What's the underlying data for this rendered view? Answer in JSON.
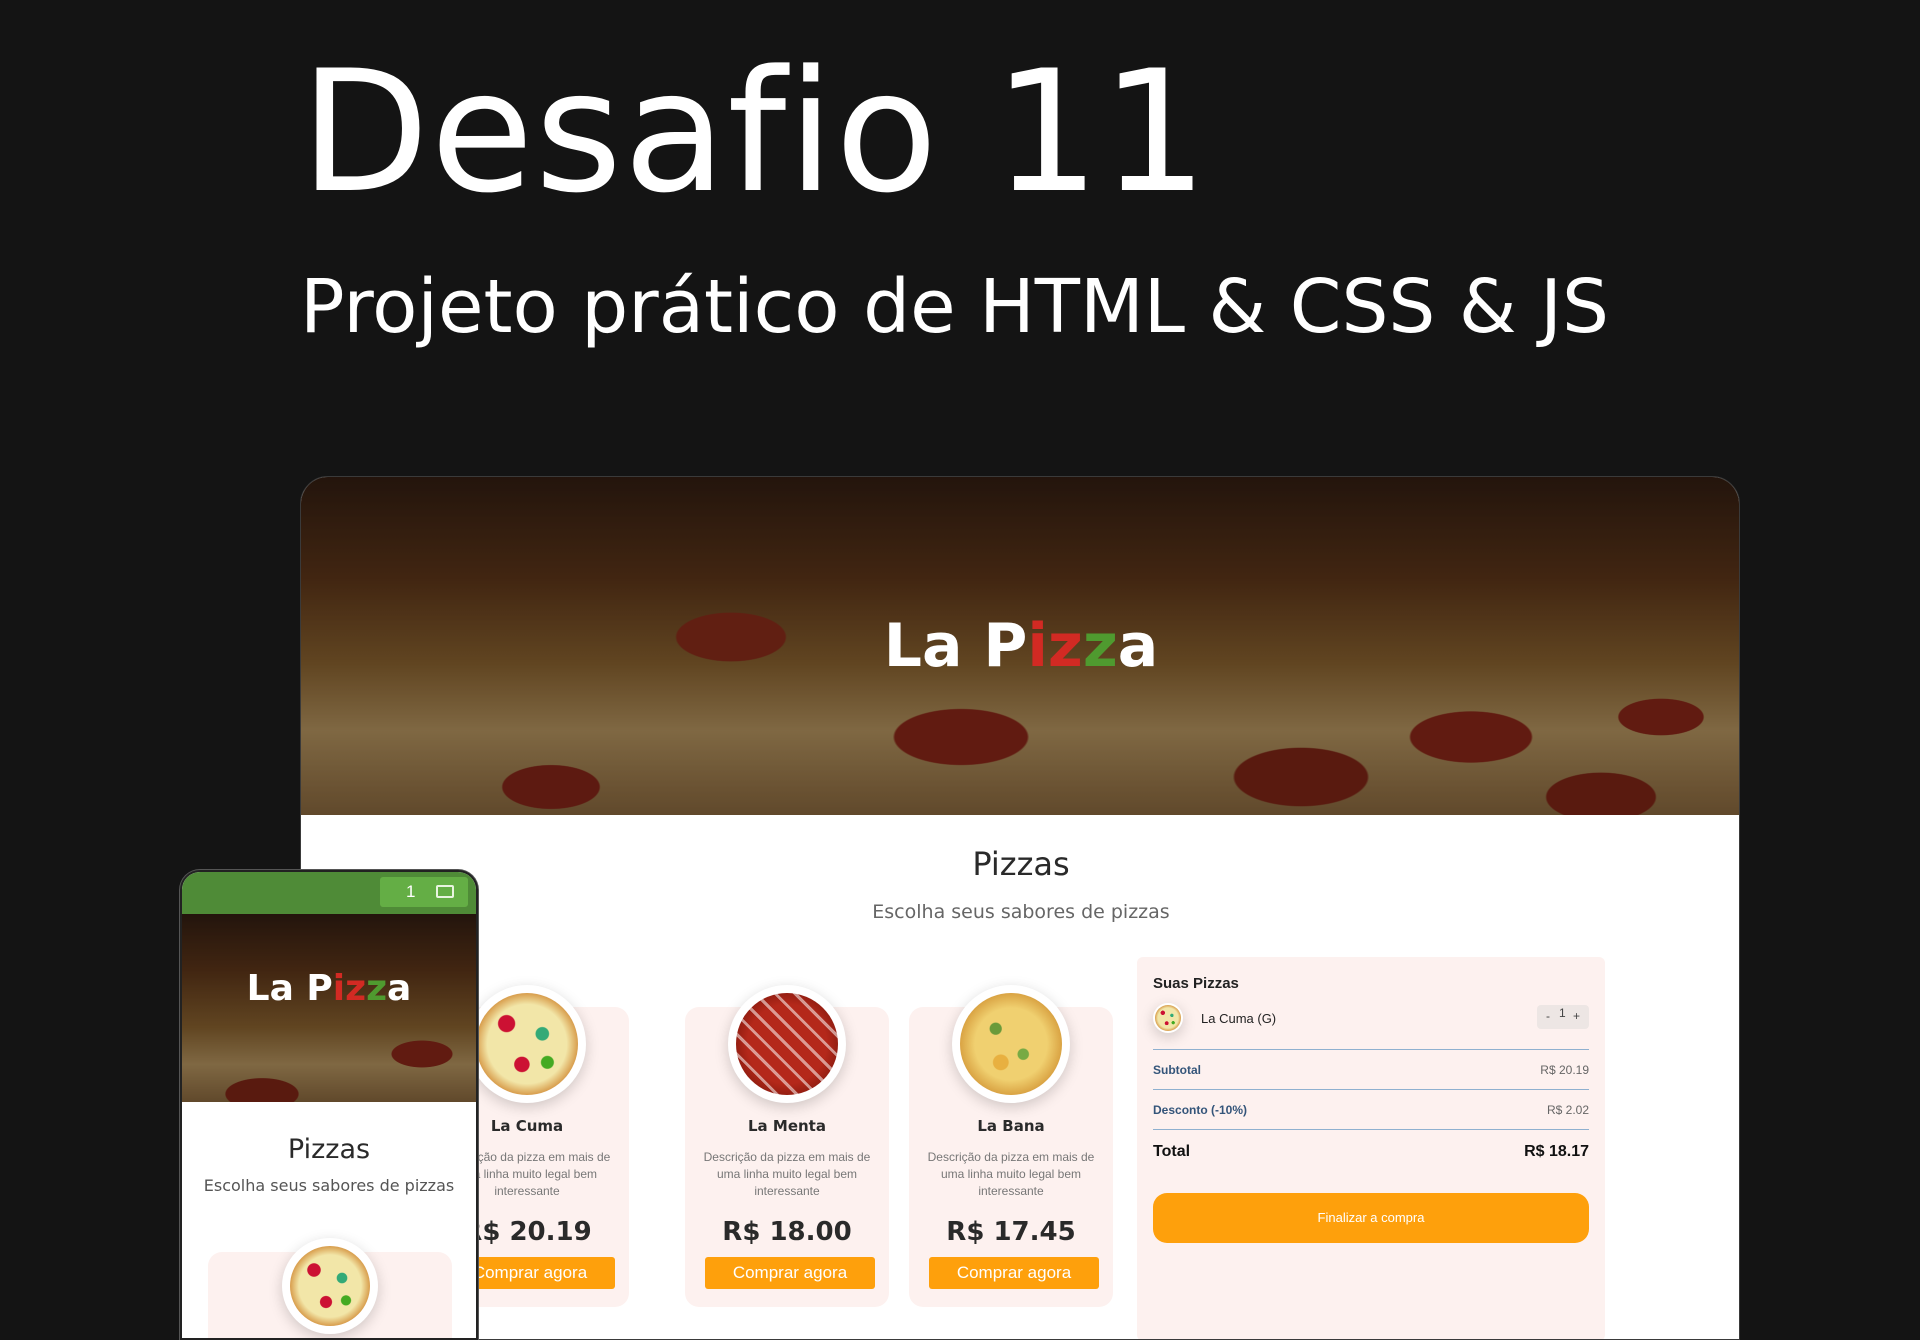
{
  "hero": {
    "title": "Desafio 11",
    "subtitle": "Projeto prático de HTML & CSS & JS"
  },
  "brand": {
    "logo_a": "La P",
    "logo_i": "i",
    "logo_z1": "z",
    "logo_z2": "z",
    "logo_b": "a",
    "red": "#d22a23",
    "green": "#4f9a2f",
    "accent": "#fea00c"
  },
  "section": {
    "title": "Pizzas",
    "subtitle": "Escolha seus sabores de pizzas"
  },
  "products": [
    {
      "name": "La Cuma",
      "description": "Descrição da pizza em mais de uma linha muito legal bem interessante",
      "price": "R$ 20.19",
      "button": "Comprar agora"
    },
    {
      "name": "La Menta",
      "description": "Descrição da pizza em mais de uma linha muito legal bem interessante",
      "price": "R$ 18.00",
      "button": "Comprar agora"
    },
    {
      "name": "La Bana",
      "description": "Descrição da pizza em mais de uma linha muito legal bem interessante",
      "price": "R$ 17.45",
      "button": "Comprar agora"
    }
  ],
  "cart": {
    "title": "Suas Pizzas",
    "item": {
      "name": "La Cuma (G)",
      "qty": "1",
      "minus": "-",
      "plus": "+"
    },
    "subtotal_label": "Subtotal",
    "subtotal": "R$ 20.19",
    "discount_label": "Desconto (-10%)",
    "discount": "R$ 2.02",
    "total_label": "Total",
    "total": "R$ 18.17",
    "checkout": "Finalizar a compra"
  },
  "mobile": {
    "cart_count": "1",
    "cart_icon": "cart-icon"
  }
}
